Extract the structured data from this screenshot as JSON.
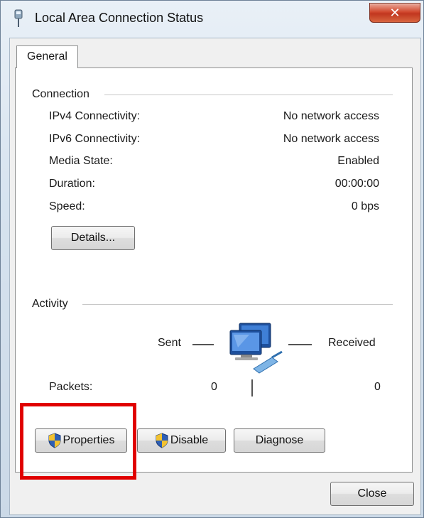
{
  "window": {
    "title": "Local Area Connection Status",
    "close_glyph": "✕"
  },
  "tabs": [
    {
      "label": "General"
    }
  ],
  "connection": {
    "heading": "Connection",
    "rows": [
      {
        "label": "IPv4 Connectivity:",
        "value": "No network access"
      },
      {
        "label": "IPv6 Connectivity:",
        "value": "No network access"
      },
      {
        "label": "Media State:",
        "value": "Enabled"
      },
      {
        "label": "Duration:",
        "value": "00:00:00"
      },
      {
        "label": "Speed:",
        "value": "0 bps"
      }
    ],
    "details_button": "Details..."
  },
  "activity": {
    "heading": "Activity",
    "sent_label": "Sent",
    "received_label": "Received",
    "packets_label": "Packets:",
    "packets_sent": "0",
    "packets_received": "0",
    "icon": "network-computers-icon"
  },
  "actions": {
    "properties": "Properties",
    "disable": "Disable",
    "diagnose": "Diagnose",
    "shield_icon": "uac-shield-icon"
  },
  "footer": {
    "close": "Close"
  },
  "colors": {
    "highlight": "#e00000",
    "close_button": "#c1361f"
  }
}
